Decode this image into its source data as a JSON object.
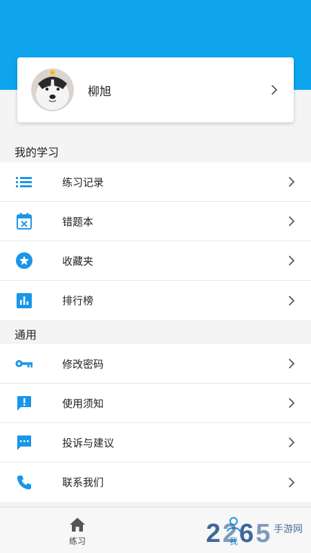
{
  "colors": {
    "accent": "#0ea5ee",
    "icon": "#1a96e8",
    "chevron": "#555555"
  },
  "profile": {
    "name": "柳旭"
  },
  "sections": [
    {
      "title": "我的学习",
      "items": [
        {
          "label": "练习记录",
          "icon": "list-icon"
        },
        {
          "label": "错题本",
          "icon": "calendar-x-icon"
        },
        {
          "label": "收藏夹",
          "icon": "star-icon"
        },
        {
          "label": "排行榜",
          "icon": "bar-chart-icon"
        }
      ]
    },
    {
      "title": "通用",
      "items": [
        {
          "label": "修改密码",
          "icon": "key-icon"
        },
        {
          "label": "使用须知",
          "icon": "alert-message-icon"
        },
        {
          "label": "投诉与建议",
          "icon": "chat-message-icon"
        },
        {
          "label": "联系我们",
          "icon": "phone-icon"
        }
      ]
    }
  ],
  "tabbar": {
    "tabs": [
      {
        "label": "练习",
        "icon": "home-icon"
      },
      {
        "label": "我",
        "icon": "person-icon",
        "active": true
      }
    ]
  },
  "watermark": {
    "logo": "2265",
    "text": "手游网"
  }
}
